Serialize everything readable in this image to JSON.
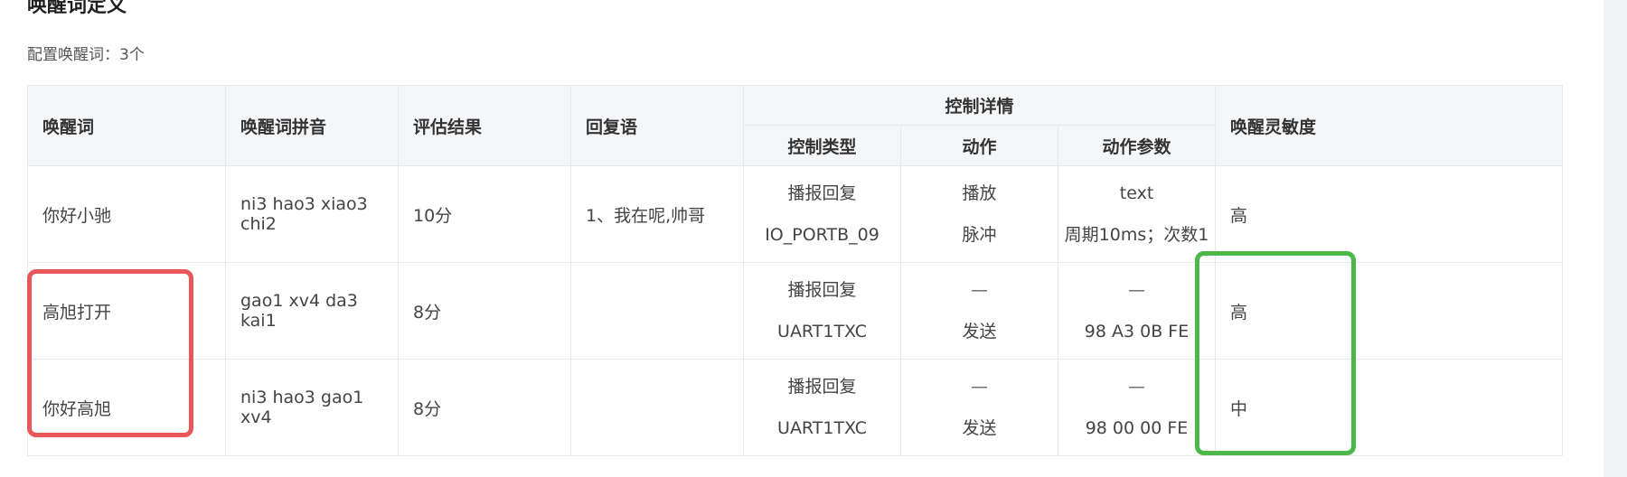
{
  "section": {
    "title": "唤醒词定义",
    "summary": "配置唤醒词：3个"
  },
  "table": {
    "headers": {
      "wakeword": "唤醒词",
      "pinyin": "唤醒词拼音",
      "score": "评估结果",
      "reply": "回复语",
      "control_group": "控制详情",
      "control_type": "控制类型",
      "action": "动作",
      "action_params": "动作参数",
      "sensitivity": "唤醒灵敏度"
    },
    "rows": [
      {
        "wakeword": "你好小驰",
        "pinyin": "ni3 hao3 xiao3 chi2",
        "score": "10分",
        "reply": "1、我在呢,帅哥",
        "controls": [
          {
            "type": "播报回复",
            "action": "播放",
            "params": "text"
          },
          {
            "type": "IO_PORTB_09",
            "action": "脉冲",
            "params": "周期10ms；次数1"
          }
        ],
        "sensitivity": "高"
      },
      {
        "wakeword": "高旭打开",
        "pinyin": "gao1 xv4 da3 kai1",
        "score": "8分",
        "reply": "",
        "controls": [
          {
            "type": "播报回复",
            "action": "—",
            "params": "—"
          },
          {
            "type": "UART1TXC",
            "action": "发送",
            "params": "98 A3 0B FE"
          }
        ],
        "sensitivity": "高"
      },
      {
        "wakeword": "你好高旭",
        "pinyin": "ni3 hao3 gao1 xv4",
        "score": "8分",
        "reply": "",
        "controls": [
          {
            "type": "播报回复",
            "action": "—",
            "params": "—"
          },
          {
            "type": "UART1TXC",
            "action": "发送",
            "params": "98 00 00 FE"
          }
        ],
        "sensitivity": "中"
      }
    ]
  },
  "highlights": {
    "red_color": "#e85858",
    "green_color": "#4cb84a"
  }
}
